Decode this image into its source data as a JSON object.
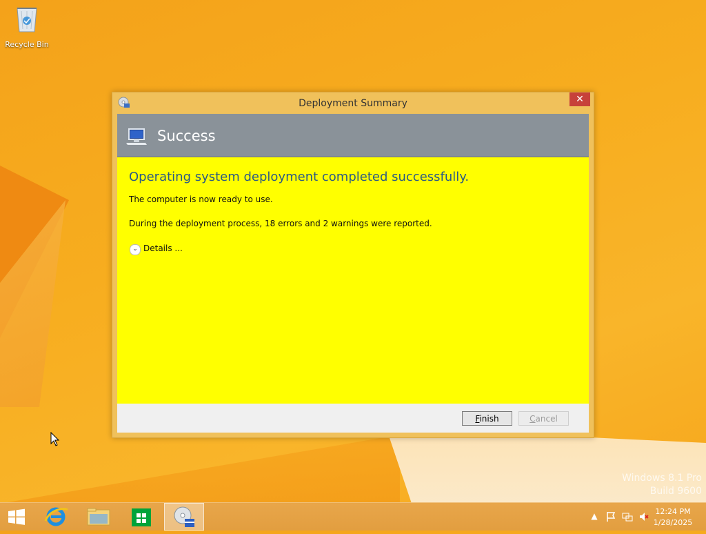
{
  "desktop": {
    "recycle_bin_label": "Recycle Bin",
    "watermark_line1": "Windows 8.1 Pro",
    "watermark_line2": "Build 9600"
  },
  "dialog": {
    "title": "Deployment Summary",
    "close_label": "✕",
    "banner_title": "Success",
    "heading": "Operating system deployment completed successfully.",
    "message_ready": "The computer is now ready to use.",
    "message_errors": "During the deployment process, 18 errors and 2 warnings were reported.",
    "details_label": "Details ...",
    "finish_button": "Finish",
    "cancel_button": "Cancel",
    "content_bg": "#ffff00",
    "banner_bg": "#8a9299",
    "heading_color": "#2b5a84"
  },
  "taskbar": {
    "items": [
      {
        "name": "start",
        "icon": "windows-logo-icon"
      },
      {
        "name": "internet-explorer",
        "icon": "internet-explorer-icon"
      },
      {
        "name": "file-explorer",
        "icon": "folder-icon"
      },
      {
        "name": "store",
        "icon": "store-icon"
      },
      {
        "name": "deployment-wizard",
        "icon": "deployment-disc-icon",
        "active": true
      }
    ],
    "tray": {
      "icons": [
        "show-hidden-icons-icon",
        "action-center-flag-icon",
        "network-icon",
        "volume-muted-icon"
      ],
      "time": "12:24 PM",
      "date": "1/28/2025"
    }
  }
}
